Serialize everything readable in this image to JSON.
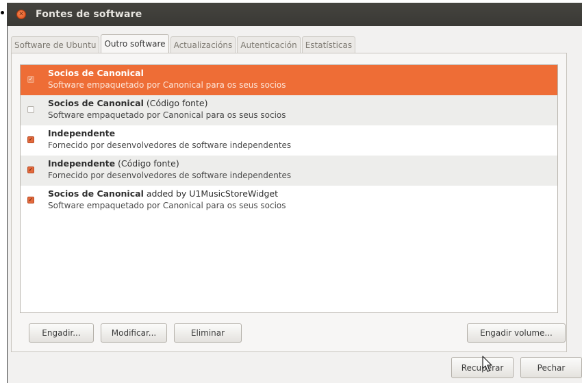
{
  "window": {
    "title": "Fontes de software"
  },
  "tabs": [
    {
      "label": "Software de Ubuntu"
    },
    {
      "label": "Outro software"
    },
    {
      "label": "Actualizacións"
    },
    {
      "label": "Autenticación"
    },
    {
      "label": "Estatísticas"
    }
  ],
  "sources": [
    {
      "name": "Socios de Canonical",
      "suffix": "",
      "description": "Software empaquetado por Canonical para os seus socios",
      "checked": true,
      "selected": true
    },
    {
      "name": "Socios de Canonical",
      "suffix": " (Código fonte)",
      "description": "Software empaquetado por Canonical para os seus socios",
      "checked": false,
      "selected": false
    },
    {
      "name": "Independente",
      "suffix": "",
      "description": "Fornecido por desenvolvedores de software independentes",
      "checked": true,
      "selected": false
    },
    {
      "name": "Independente",
      "suffix": " (Código fonte)",
      "description": "Fornecido por desenvolvedores de software independentes",
      "checked": true,
      "selected": false
    },
    {
      "name": "Socios de Canonical",
      "suffix": " added by U1MusicStoreWidget",
      "description": "Software empaquetado por Canonical para os seus socios",
      "checked": true,
      "selected": false
    }
  ],
  "buttons": {
    "add": "Engadir...",
    "edit": "Modificar...",
    "remove": "Eliminar",
    "add_volume": "Engadir volume...",
    "revert": "Recuperar",
    "close": "Pechar"
  },
  "colors": {
    "accent": "#ee6d36",
    "titlebar": "#3c3b37"
  }
}
